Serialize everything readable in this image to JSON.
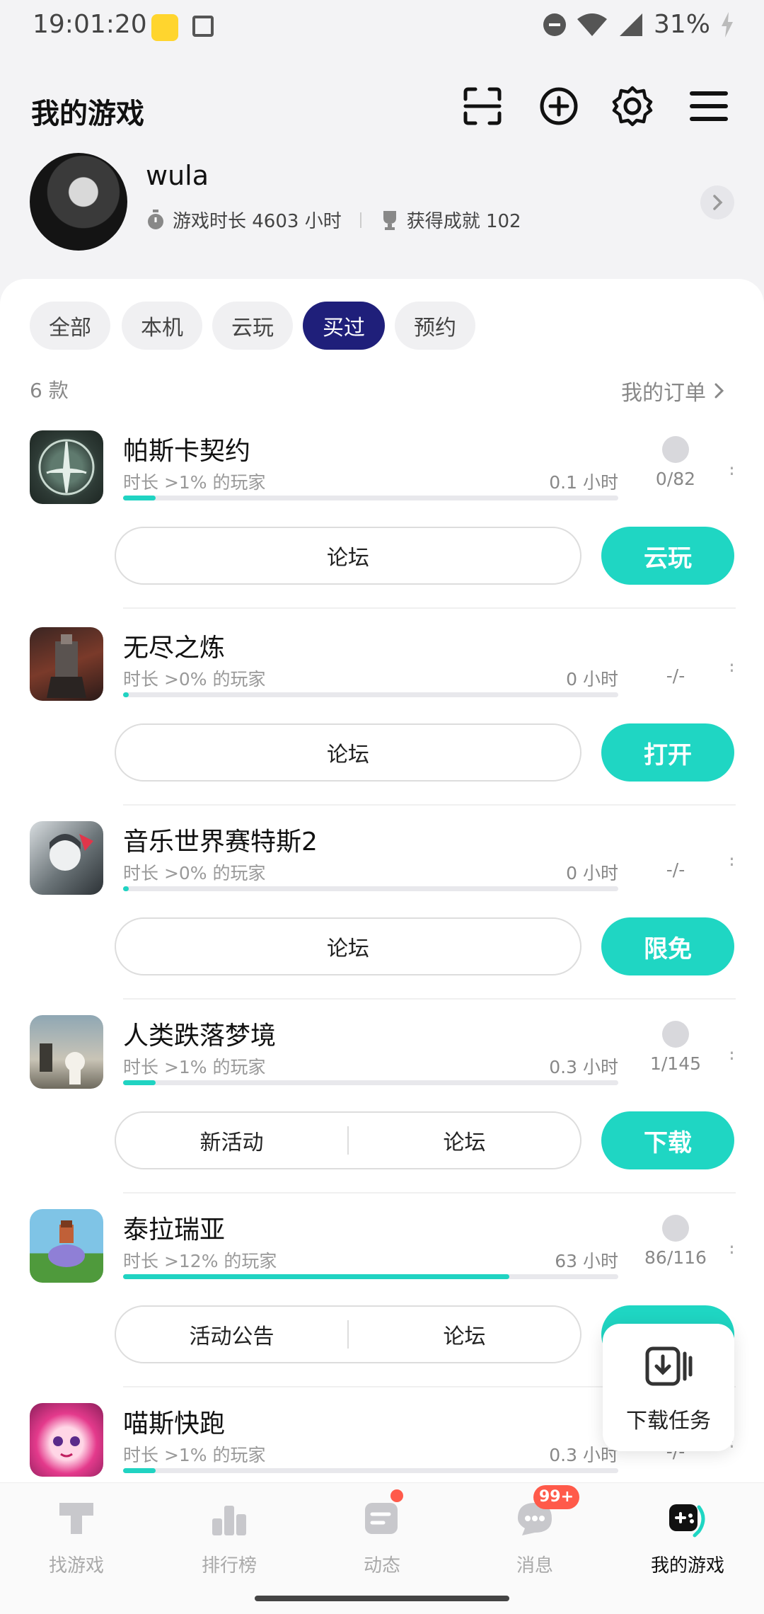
{
  "status_bar": {
    "time": "19:01:20",
    "battery": "31%"
  },
  "header": {
    "title": "我的游戏"
  },
  "profile": {
    "username": "wula",
    "playtime": "游戏时长 4603 小时",
    "achievements": "获得成就 102"
  },
  "filters": [
    "全部",
    "本机",
    "云玩",
    "买过",
    "预约"
  ],
  "active_filter": "买过",
  "list_meta": {
    "count": "6 款",
    "orders": "我的订单"
  },
  "games": [
    {
      "name": "帕斯卡契约",
      "sub": "时长 >1% 的玩家",
      "hours": "0.1 小时",
      "progress": 0.01,
      "achievements": "0/82",
      "has_trophy": true,
      "links": [
        "论坛"
      ],
      "action": "云玩"
    },
    {
      "name": "无尽之炼",
      "sub": "时长 >0% 的玩家",
      "hours": "0 小时",
      "progress": 0.0,
      "achievements": "-/-",
      "has_trophy": false,
      "links": [
        "论坛"
      ],
      "action": "打开"
    },
    {
      "name": "音乐世界赛特斯2",
      "sub": "时长 >0% 的玩家",
      "hours": "0 小时",
      "progress": 0.0,
      "achievements": "-/-",
      "has_trophy": false,
      "links": [
        "论坛"
      ],
      "action": "限免"
    },
    {
      "name": "人类跌落梦境",
      "sub": "时长 >1% 的玩家",
      "hours": "0.3 小时",
      "progress": 0.01,
      "achievements": "1/145",
      "has_trophy": true,
      "links": [
        "新活动",
        "论坛"
      ],
      "action": "下载"
    },
    {
      "name": "泰拉瑞亚",
      "sub": "时长 >12% 的玩家",
      "hours": "63 小时",
      "progress": 0.12,
      "achievements": "86/116",
      "has_trophy": true,
      "links": [
        "活动公告",
        "论坛"
      ],
      "action": ""
    },
    {
      "name": "喵斯快跑",
      "sub": "时长 >1% 的玩家",
      "hours": "0.3 小时",
      "progress": 0.01,
      "achievements": "-/-",
      "has_trophy": false,
      "links": [],
      "action": ""
    }
  ],
  "download_task": {
    "label": "下载任务"
  },
  "nav": {
    "items": [
      "找游戏",
      "排行榜",
      "动态",
      "消息",
      "我的游戏"
    ],
    "active": "我的游戏",
    "message_badge": "99+"
  },
  "colors": {
    "accent": "#1fd6c3",
    "active_chip": "#1f1f7a",
    "badge": "#ff5a4a"
  }
}
